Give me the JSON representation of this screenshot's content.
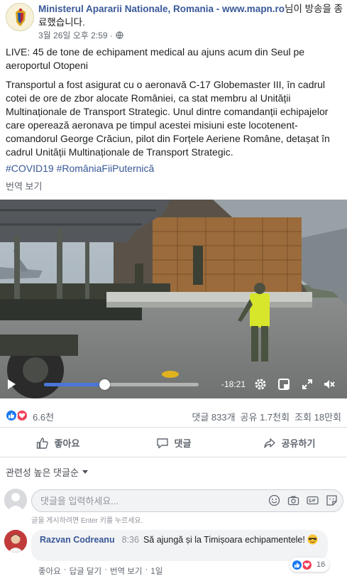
{
  "post": {
    "page_name": "Ministerul Apararii Nationale, Romania - www.mapn.ro",
    "header_suffix": "님이 방송을 종료했습니다.",
    "timestamp": "3월 26일 오후 2:59 ·",
    "live_title": "LIVE: 45 de tone de echipament medical au ajuns acum din Seul pe aeroportul Otopeni",
    "body": "Transportul a fost asigurat cu o aeronavă C-17 Globemaster III, în cadrul cotei de ore de zbor alocate României, ca stat membru al Unității Multinaționale de Transport Strategic. Unul dintre comandanții echipajelor care operează aeronava pe timpul acestei misiuni este locotenent-comandorul George Crăciun, pilot din Forțele Aeriene Române, detașat în cadrul Unității Multinaționale de Transport Strategic.",
    "hashtags": "#COVID19 #RomâniaFiiPuternică",
    "translate": "번역 보기"
  },
  "video": {
    "time_remaining": "-18:21",
    "progress": 0.39,
    "icons": [
      "play-icon",
      "settings-icon",
      "fullscreen-icon",
      "volume-mute-icon",
      "expand-icon"
    ]
  },
  "stats": {
    "reaction_count": "6.6천",
    "comments": "댓글 833개",
    "shares": "공유 1.7천회",
    "views": "조회 18만회"
  },
  "actions": {
    "like": "좋아요",
    "comment": "댓글",
    "share": "공유하기"
  },
  "comments_section": {
    "sort_label": "관련성 높은 댓글순",
    "input_placeholder": "댓글을 입력하세요...",
    "hint": "글을 게시하려면 Enter 키를 누르세요.",
    "comment": {
      "author": "Razvan Codreanu",
      "time": "8:36",
      "text": "Să ajungă și la Timișoara echipamentele!",
      "like_action": "좋아요",
      "reply_action": "답글 달기",
      "translate_action": "번역 보기",
      "age": "1일",
      "reaction_count": "16"
    }
  },
  "colors": {
    "link_blue": "#385898",
    "like_blue": "#1877f2",
    "love_red": "#f33e58",
    "progress_blue": "#4a76d9"
  }
}
